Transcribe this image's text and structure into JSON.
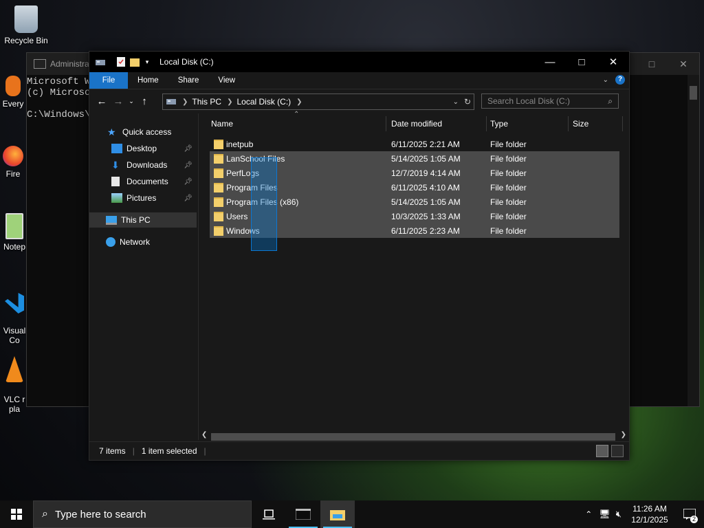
{
  "desktop": {
    "icons": [
      {
        "label": "Recycle Bin"
      },
      {
        "label": "Every"
      },
      {
        "label": "Fire"
      },
      {
        "label": "Notep"
      },
      {
        "label": "Visual\nCo"
      },
      {
        "label": "VLC r\npla"
      }
    ]
  },
  "cmd": {
    "title": "Administrat",
    "lines": [
      "Microsoft W",
      "(c) Microso",
      "",
      "C:\\Windows\\s"
    ]
  },
  "explorer": {
    "title": "Local Disk (C:)",
    "ribbon_tabs": [
      "File",
      "Home",
      "Share",
      "View"
    ],
    "breadcrumb": [
      "This PC",
      "Local Disk (C:)"
    ],
    "search_placeholder": "Search Local Disk (C:)",
    "nav": {
      "quick_access": "Quick access",
      "desktop": "Desktop",
      "downloads": "Downloads",
      "documents": "Documents",
      "pictures": "Pictures",
      "this_pc": "This PC",
      "network": "Network"
    },
    "columns": [
      "Name",
      "Date modified",
      "Type",
      "Size"
    ],
    "files": [
      {
        "name": "inetpub",
        "date": "6/11/2025 2:21 AM",
        "type": "File folder",
        "selected": false
      },
      {
        "name": "LanSchool Files",
        "date": "5/14/2025 1:05 AM",
        "type": "File folder",
        "selected": true
      },
      {
        "name": "PerfLogs",
        "date": "12/7/2019 4:14 AM",
        "type": "File folder",
        "selected": true
      },
      {
        "name": "Program Files",
        "date": "6/11/2025 4:10 AM",
        "type": "File folder",
        "selected": true
      },
      {
        "name": "Program Files (x86)",
        "date": "5/14/2025 1:05 AM",
        "type": "File folder",
        "selected": true
      },
      {
        "name": "Users",
        "date": "10/3/2025 1:33 AM",
        "type": "File folder",
        "selected": true
      },
      {
        "name": "Windows",
        "date": "6/11/2025 2:23 AM",
        "type": "File folder",
        "selected": true
      }
    ],
    "status": {
      "items": "7 items",
      "selected": "1 item selected"
    }
  },
  "taskbar": {
    "search_placeholder": "Type here to search",
    "time": "11:26 AM",
    "date": "12/1/2025",
    "notification_count": "2"
  },
  "colors": {
    "accent": "#1a73c8",
    "selection": "#4a4a4a",
    "folder": "#f3cf6b"
  }
}
